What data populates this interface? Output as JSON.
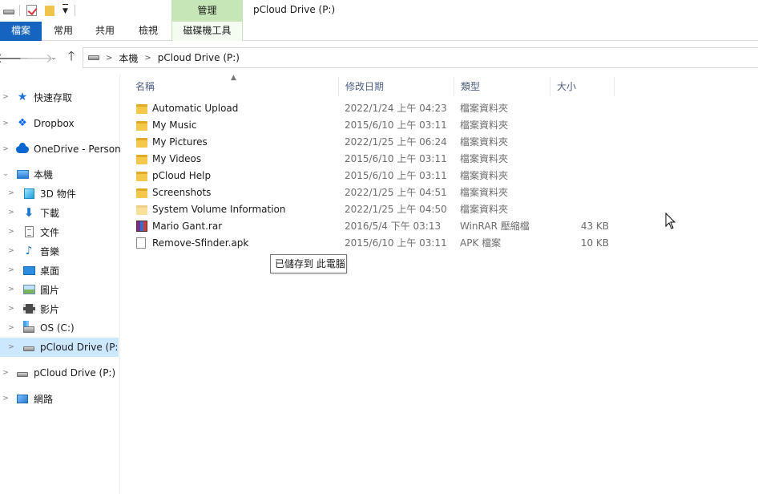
{
  "window": {
    "title": "pCloud Drive (P:)",
    "context_group": "管理"
  },
  "ribbon": {
    "tabs": [
      {
        "label": "檔案"
      },
      {
        "label": "常用"
      },
      {
        "label": "共用"
      },
      {
        "label": "檢視"
      },
      {
        "label": "磁碟機工具"
      }
    ]
  },
  "address": {
    "crumbs": [
      "本機",
      "pCloud Drive (P:)"
    ]
  },
  "nav_pane": {
    "items": [
      {
        "label": "快速存取",
        "icon": "star-icon"
      },
      {
        "label": "Dropbox",
        "icon": "dropbox-icon"
      },
      {
        "label": "OneDrive - Personal",
        "icon": "onedrive-cloud-icon"
      },
      {
        "label": "本機",
        "icon": "computer-icon",
        "expanded": true
      },
      {
        "label": "3D 物件",
        "icon": "3d-objects-icon"
      },
      {
        "label": "下載",
        "icon": "download-icon"
      },
      {
        "label": "文件",
        "icon": "document-icon"
      },
      {
        "label": "音樂",
        "icon": "music-icon"
      },
      {
        "label": "桌面",
        "icon": "desktop-icon"
      },
      {
        "label": "圖片",
        "icon": "picture-icon"
      },
      {
        "label": "影片",
        "icon": "video-icon"
      },
      {
        "label": "OS (C:)",
        "icon": "os-drive-icon"
      },
      {
        "label": "pCloud Drive (P:)",
        "icon": "drive-icon",
        "selected": true
      },
      {
        "label": "pCloud Drive (P:)",
        "icon": "drive-icon"
      },
      {
        "label": "網路",
        "icon": "network-icon"
      }
    ]
  },
  "columns": {
    "name": "名稱",
    "date": "修改日期",
    "type": "類型",
    "size": "大小"
  },
  "files": [
    {
      "name": "Automatic Upload",
      "date": "2022/1/24 上午 04:23",
      "type": "檔案資料夾",
      "size": "",
      "icon": "folder-icon"
    },
    {
      "name": "My Music",
      "date": "2015/6/10 上午 03:11",
      "type": "檔案資料夾",
      "size": "",
      "icon": "folder-icon"
    },
    {
      "name": "My Pictures",
      "date": "2022/1/25 上午 06:24",
      "type": "檔案資料夾",
      "size": "",
      "icon": "folder-icon"
    },
    {
      "name": "My Videos",
      "date": "2015/6/10 上午 03:11",
      "type": "檔案資料夾",
      "size": "",
      "icon": "folder-icon"
    },
    {
      "name": "pCloud Help",
      "date": "2015/6/10 上午 03:11",
      "type": "檔案資料夾",
      "size": "",
      "icon": "folder-icon"
    },
    {
      "name": "Screenshots",
      "date": "2022/1/25 上午 04:51",
      "type": "檔案資料夾",
      "size": "",
      "icon": "folder-icon"
    },
    {
      "name": "System Volume Information",
      "date": "2022/1/25 上午 04:50",
      "type": "檔案資料夾",
      "size": "",
      "icon": "folder-icon-faded"
    },
    {
      "name": "Mario Gant.rar",
      "date": "2016/5/4 下午 03:13",
      "type": "WinRAR 壓縮檔",
      "size": "43 KB",
      "icon": "rar-icon"
    },
    {
      "name": "Remove-Sfinder.apk",
      "date": "2015/6/10 上午 03:11",
      "type": "APK 檔案",
      "size": "10 KB",
      "icon": "file-icon"
    }
  ],
  "tooltip": {
    "text": "已儲存到 此電腦"
  },
  "colors": {
    "file_tab": "#1565c0",
    "context_tab": "#c7e6b8",
    "selection": "#cce8ff",
    "header_text": "#4d6082",
    "folder": "#f3c84b"
  }
}
